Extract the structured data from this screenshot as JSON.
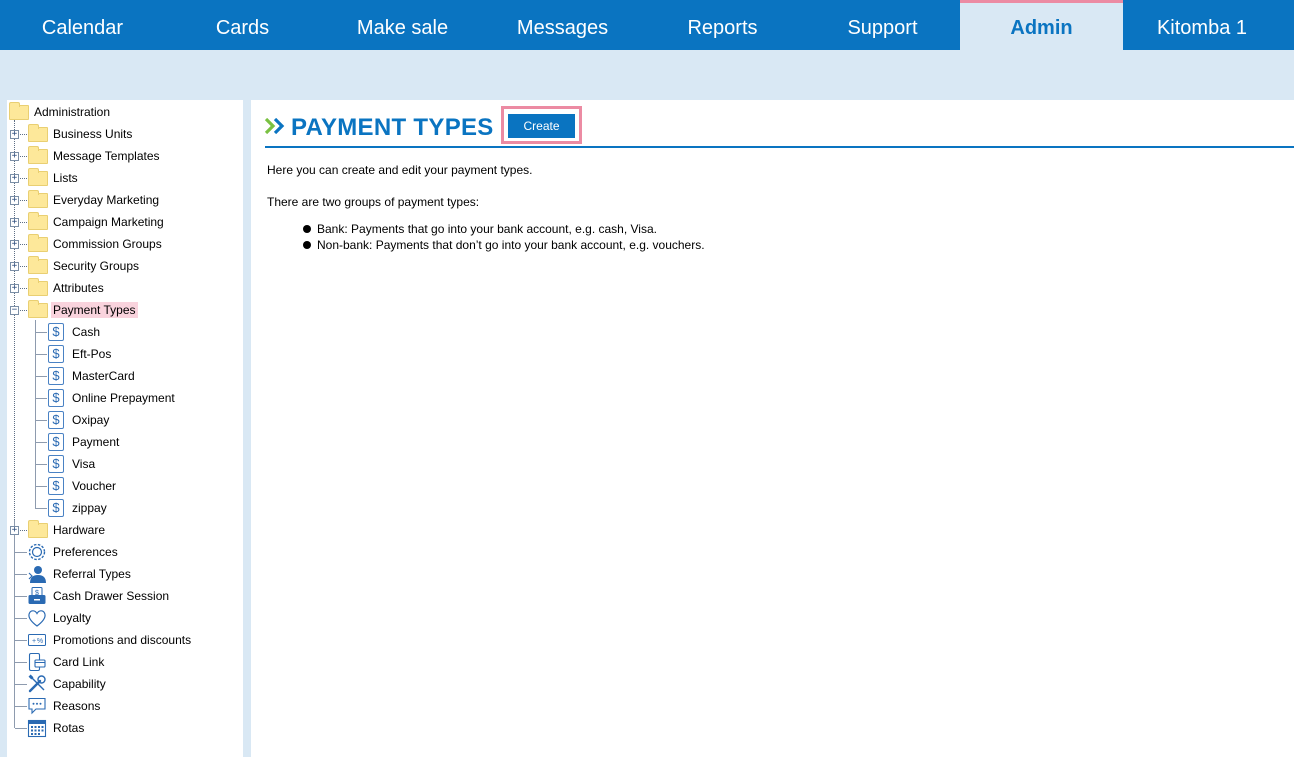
{
  "nav": {
    "tabs": [
      {
        "label": "Calendar",
        "active": false
      },
      {
        "label": "Cards",
        "active": false
      },
      {
        "label": "Make sale",
        "active": false
      },
      {
        "label": "Messages",
        "active": false
      },
      {
        "label": "Reports",
        "active": false
      },
      {
        "label": "Support",
        "active": false
      },
      {
        "label": "Admin",
        "active": true
      },
      {
        "label": "Kitomba 1",
        "active": false
      }
    ]
  },
  "colors": {
    "brand": "#0a74c1",
    "highlight": "#ec8ba3",
    "selected_bg": "#f9d3dd",
    "page_bg": "#d9e8f4"
  },
  "tree": {
    "root": "Administration",
    "folders": [
      "Business Units",
      "Message Templates",
      "Lists",
      "Everyday Marketing",
      "Campaign Marketing",
      "Commission Groups",
      "Security Groups",
      "Attributes"
    ],
    "selected_folder": "Payment Types",
    "payment_types": [
      "Cash",
      "Eft-Pos",
      "MasterCard",
      "Online Prepayment",
      "Oxipay",
      "Payment",
      "Visa",
      "Voucher",
      "zippay"
    ],
    "hardware": "Hardware",
    "items": [
      {
        "label": "Preferences",
        "icon": "gear-icon"
      },
      {
        "label": "Referral Types",
        "icon": "person-icon"
      },
      {
        "label": "Cash Drawer Session",
        "icon": "cash-drawer-icon"
      },
      {
        "label": "Loyalty",
        "icon": "heart-icon"
      },
      {
        "label": "Promotions and discounts",
        "icon": "percent-tag-icon"
      },
      {
        "label": "Card Link",
        "icon": "phone-card-icon"
      },
      {
        "label": "Capability",
        "icon": "tools-icon"
      },
      {
        "label": "Reasons",
        "icon": "speech-bubble-icon"
      },
      {
        "label": "Rotas",
        "icon": "calendar-icon"
      }
    ]
  },
  "main": {
    "title": "PAYMENT TYPES",
    "create_label": "Create",
    "intro": "Here you can create and edit your payment types.",
    "groups_intro": "There are two groups of payment types:",
    "bullets": [
      "Bank: Payments that go into your bank account, e.g. cash, Visa.",
      "Non-bank: Payments that don’t go into your bank account, e.g. vouchers."
    ]
  }
}
